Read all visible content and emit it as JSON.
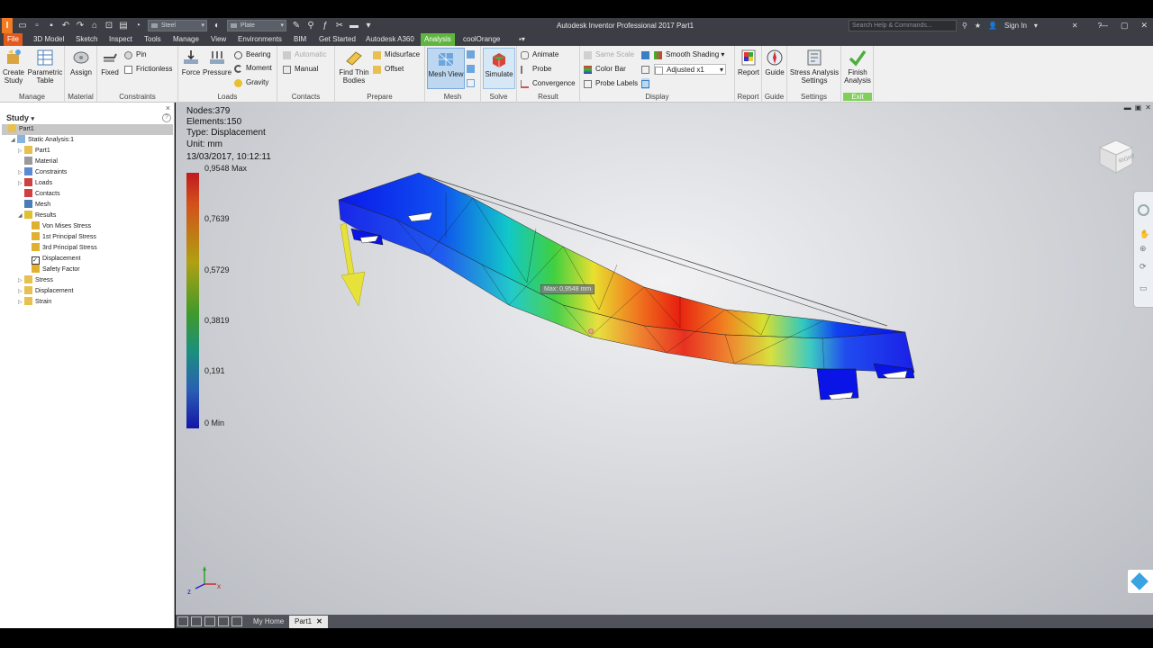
{
  "app": {
    "title": "Autodesk Inventor Professional 2017   Part1",
    "logo": "I",
    "qat_material": "Steel",
    "qat_appearance": "Plate",
    "search_placeholder": "Search Help & Commands...",
    "sign_in": "Sign In",
    "help": "?"
  },
  "tabs": [
    "File",
    "3D Model",
    "Sketch",
    "Inspect",
    "Tools",
    "Manage",
    "View",
    "Environments",
    "BIM",
    "Get Started",
    "Autodesk A360",
    "Analysis",
    "coolOrange"
  ],
  "active_tab": "Analysis",
  "ribbon": {
    "manage": {
      "label": "Manage",
      "create_study": "Create\nStudy",
      "parametric_table": "Parametric\nTable"
    },
    "material": {
      "label": "Material",
      "assign": "Assign"
    },
    "constraints": {
      "label": "Constraints",
      "fixed": "Fixed",
      "pin": "Pin",
      "frictionless": "Frictionless"
    },
    "loads": {
      "label": "Loads",
      "force": "Force",
      "pressure": "Pressure",
      "bearing": "Bearing",
      "moment": "Moment",
      "gravity": "Gravity"
    },
    "contacts": {
      "label": "Contacts",
      "automatic": "Automatic",
      "manual": "Manual"
    },
    "prepare": {
      "label": "Prepare",
      "find_thin_bodies": "Find Thin\nBodies",
      "midsurface": "Midsurface",
      "offset": "Offset"
    },
    "mesh": {
      "label": "Mesh",
      "mesh_view": "Mesh View"
    },
    "solve": {
      "label": "Solve",
      "simulate": "Simulate"
    },
    "result": {
      "label": "Result",
      "animate": "Animate",
      "probe": "Probe",
      "convergence": "Convergence"
    },
    "display": {
      "label": "Display",
      "same_scale": "Same Scale",
      "color_bar": "Color Bar",
      "probe_labels": "Probe Labels",
      "shading": "Smooth Shading",
      "adjusted": "Adjusted x1"
    },
    "report": {
      "label": "Report",
      "report": "Report"
    },
    "guide": {
      "label": "Guide",
      "guide": "Guide"
    },
    "settings": {
      "label": "Settings",
      "stress_analysis_settings": "Stress Analysis\nSettings"
    },
    "exit": {
      "label": "Exit",
      "finish_analysis": "Finish\nAnalysis"
    }
  },
  "browser": {
    "title": "Study",
    "close": "×",
    "items": [
      {
        "label": "Part1",
        "indent": 0,
        "tri": "",
        "icon": "part-icon",
        "selected": true
      },
      {
        "label": "Static Analysis:1",
        "indent": 1,
        "tri": "◢",
        "icon": "analysis-icon"
      },
      {
        "label": "Part1",
        "indent": 2,
        "tri": "▷",
        "icon": "part-icon"
      },
      {
        "label": "Material",
        "indent": 2,
        "tri": "",
        "icon": "material-icon"
      },
      {
        "label": "Constraints",
        "indent": 2,
        "tri": "▷",
        "icon": "constraint-icon"
      },
      {
        "label": "Loads",
        "indent": 2,
        "tri": "▷",
        "icon": "load-icon"
      },
      {
        "label": "Contacts",
        "indent": 2,
        "tri": "",
        "icon": "contact-icon"
      },
      {
        "label": "Mesh",
        "indent": 2,
        "tri": "",
        "icon": "mesh-icon"
      },
      {
        "label": "Results",
        "indent": 2,
        "tri": "◢",
        "icon": "results-icon"
      },
      {
        "label": "Von Mises Stress",
        "indent": 3,
        "tri": "",
        "icon": "result-item-icon"
      },
      {
        "label": "1st Principal Stress",
        "indent": 3,
        "tri": "",
        "icon": "result-item-icon"
      },
      {
        "label": "3rd Principal Stress",
        "indent": 3,
        "tri": "",
        "icon": "result-item-icon"
      },
      {
        "label": "Displacement",
        "indent": 3,
        "tri": "",
        "icon": "checked-icon"
      },
      {
        "label": "Safety Factor",
        "indent": 3,
        "tri": "",
        "icon": "result-item-icon"
      },
      {
        "label": "Stress",
        "indent": 2,
        "tri": "▷",
        "icon": "folder-icon"
      },
      {
        "label": "Displacement",
        "indent": 2,
        "tri": "▷",
        "icon": "folder-icon"
      },
      {
        "label": "Strain",
        "indent": 2,
        "tri": "▷",
        "icon": "folder-icon"
      }
    ]
  },
  "viewport": {
    "info": [
      "Nodes:379",
      "Elements:150",
      "Type: Displacement",
      "Unit: mm",
      "13/03/2017, 10:12:11"
    ],
    "legend": [
      "0,9548 Max",
      "0,7639",
      "0,5729",
      "0,3819",
      "0,191",
      "0 Min"
    ],
    "legend_max": 0.9548,
    "legend_min": 0,
    "probe_label": "Max: 0,9548 mm",
    "viewcube_label": "RIGHT",
    "axes": [
      "z",
      "x"
    ]
  },
  "doctabs": [
    "My Home",
    "Part1"
  ],
  "active_doc": "Part1",
  "colors": {
    "accent_green": "#60b540",
    "file_orange": "#e25b1d",
    "beam_blue": "#0a14e6",
    "beam_red": "#e21b10"
  }
}
